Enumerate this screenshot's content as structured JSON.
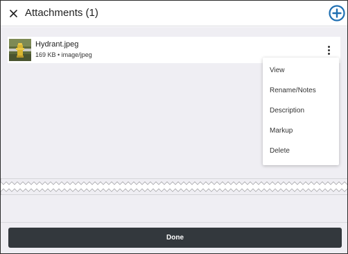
{
  "header": {
    "title": "Attachments (1)",
    "close_icon": "close-icon",
    "add_icon": "add-circle-icon",
    "accent_color": "#1f6fb2"
  },
  "attachments": [
    {
      "name": "Hydrant.jpeg",
      "meta": "169 KB • image/jpeg",
      "thumbnail_icon": "hydrant-photo-thumbnail"
    }
  ],
  "menu": {
    "items": [
      "View",
      "Rename/Notes",
      "Description",
      "Markup",
      "Delete"
    ]
  },
  "footer": {
    "done_label": "Done",
    "button_color": "#33383d"
  }
}
